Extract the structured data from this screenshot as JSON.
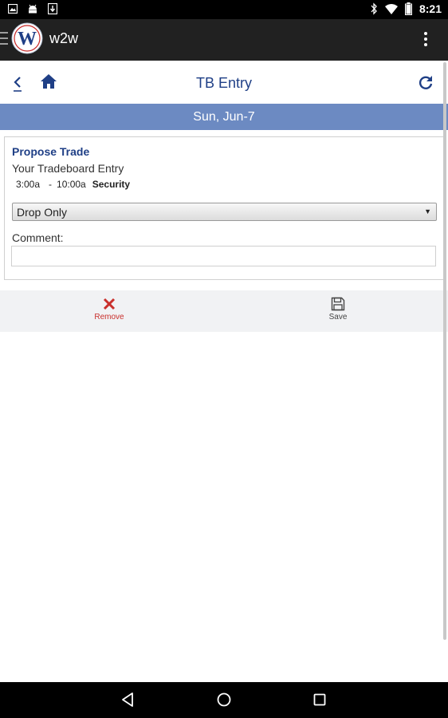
{
  "status_bar": {
    "time": "8:21"
  },
  "app_bar": {
    "app_name": "w2w",
    "logo_letter": "W"
  },
  "page_header": {
    "title": "TB Entry"
  },
  "date_bar": {
    "date": "Sun, Jun-7"
  },
  "card": {
    "title": "Propose Trade",
    "subtitle": "Your Tradeboard Entry",
    "shift": {
      "start": "3:00a",
      "separator": "-",
      "end": "10:00a",
      "role": "Security"
    },
    "trade_type": {
      "selected": "Drop Only",
      "arrow": "▼"
    },
    "comment_label": "Comment:",
    "comment_value": ""
  },
  "actions": {
    "remove_label": "Remove",
    "save_label": "Save"
  },
  "icons": {
    "status_left": [
      "image-icon",
      "android-icon",
      "download-icon"
    ],
    "status_right": [
      "bluetooth-icon",
      "wifi-icon",
      "battery-icon"
    ],
    "header": [
      "back-icon",
      "home-icon",
      "refresh-icon"
    ],
    "nav": [
      "nav-back-icon",
      "nav-home-icon",
      "nav-recents-icon"
    ]
  },
  "colors": {
    "accent": "#1f3f86",
    "date_bar": "#6c8ac2",
    "remove": "#c9302c"
  }
}
